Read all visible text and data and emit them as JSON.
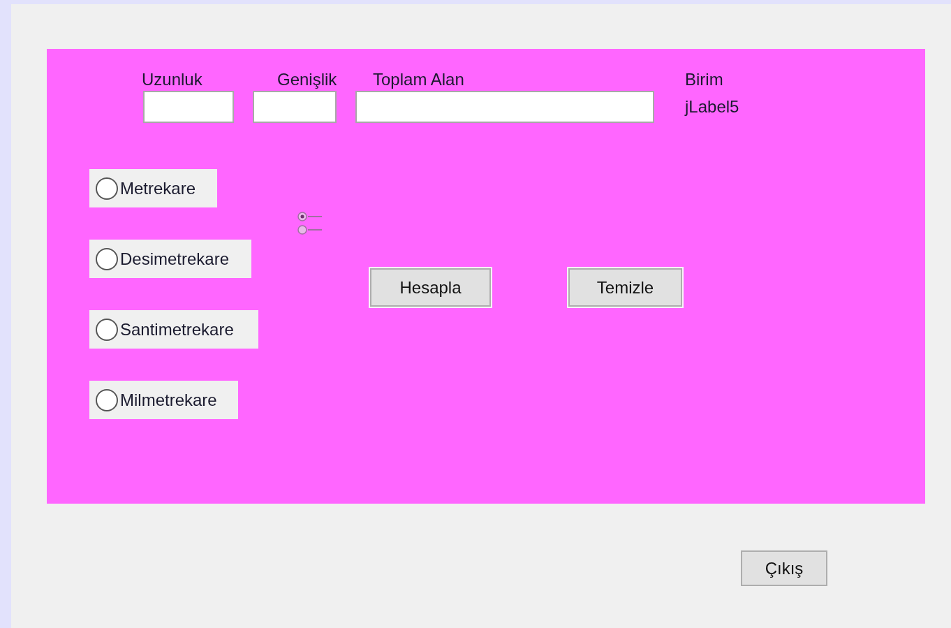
{
  "columns": [
    {
      "label": "Uzunluk",
      "kind": "field"
    },
    {
      "label": "Genişlik",
      "kind": "field"
    },
    {
      "label": "Toplam Alan",
      "kind": "field"
    },
    {
      "label": "Birim",
      "kind": "label",
      "text": "jLabel5"
    }
  ],
  "radios": [
    {
      "label": "Metrekare",
      "selected": false
    },
    {
      "label": "Desimetrekare",
      "selected": false
    },
    {
      "label": "Santimetrekare",
      "selected": false
    },
    {
      "label": "Milmetrekare",
      "selected": false
    }
  ],
  "buttons": [
    "Hesapla",
    "Temizle"
  ],
  "exit_button": "Çıkış"
}
